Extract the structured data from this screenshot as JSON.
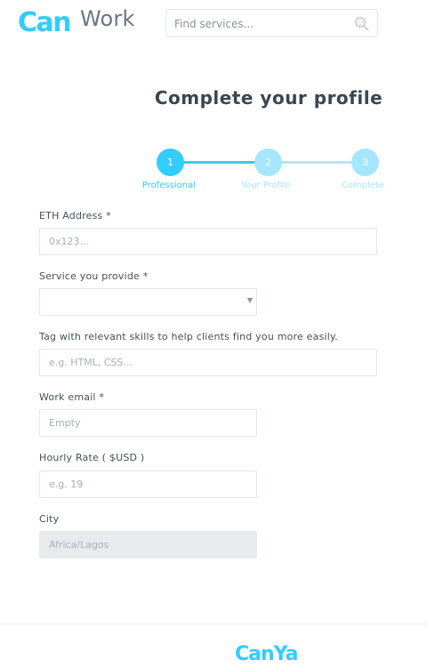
{
  "header": {
    "logo_primary": "CanYa",
    "logo_can": "Can",
    "logo_work": "Work",
    "search": {
      "placeholder": "Find services..."
    }
  },
  "page": {
    "title": "Complete your profile"
  },
  "stepper": {
    "steps": [
      {
        "number": "1",
        "label": "Professional",
        "state": "active"
      },
      {
        "number": "2",
        "label": "Your Profile",
        "state": "pending"
      },
      {
        "number": "3",
        "label": "Complete",
        "state": "pending"
      }
    ]
  },
  "form": {
    "eth_address": {
      "label": "ETH Address *",
      "placeholder": "0x123...",
      "value": ""
    },
    "service": {
      "label": "Service you provide *",
      "value": ""
    },
    "skills": {
      "label": "Tag with relevant skills to help clients find you more easily.",
      "placeholder": "e.g. HTML, CSS...",
      "value": ""
    },
    "work_email": {
      "label": "Work email *",
      "placeholder": "Empty",
      "value": ""
    },
    "hourly_rate": {
      "label": "Hourly Rate ( $USD )",
      "placeholder": "e.g. 19",
      "value": ""
    },
    "city": {
      "label": "City",
      "placeholder": "Africa/Lagos",
      "value": ""
    }
  },
  "footer": {
    "logo": "CanYa"
  },
  "colors": {
    "accent": "#33ccff",
    "accent_light": "#a6e7ff",
    "text": "#46505a",
    "border": "#e3e7eb"
  },
  "icons": {
    "search": "search-icon",
    "caret": "chevron-down-icon"
  }
}
